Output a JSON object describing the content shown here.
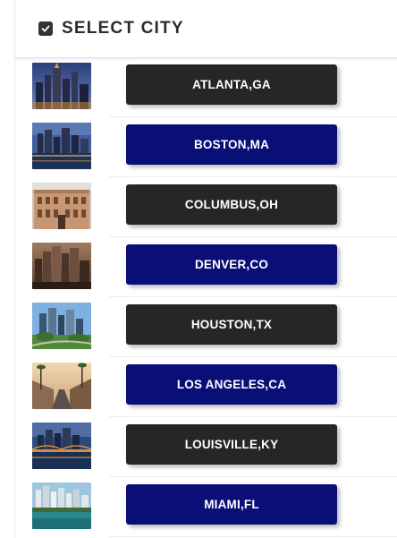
{
  "header": {
    "title": "SELECT CITY",
    "icon": "checkbox-checked-icon"
  },
  "colors": {
    "dark_button": "#252628",
    "blue_button": "#0a0f78"
  },
  "cities": [
    {
      "label": "ATLANTA,GA",
      "style": "dark",
      "image": "atlanta-skyline-photo"
    },
    {
      "label": "BOSTON,MA",
      "style": "blue",
      "image": "boston-skyline-photo"
    },
    {
      "label": "COLUMBUS,OH",
      "style": "dark",
      "image": "columbus-building-photo"
    },
    {
      "label": "DENVER,CO",
      "style": "blue",
      "image": "denver-skyline-photo"
    },
    {
      "label": "HOUSTON,TX",
      "style": "dark",
      "image": "houston-skyline-photo"
    },
    {
      "label": "LOS ANGELES,CA",
      "style": "blue",
      "image": "los-angeles-street-photo"
    },
    {
      "label": "LOUISVILLE,KY",
      "style": "dark",
      "image": "louisville-bridge-photo"
    },
    {
      "label": "MIAMI,FL",
      "style": "blue",
      "image": "miami-beach-photo"
    }
  ]
}
